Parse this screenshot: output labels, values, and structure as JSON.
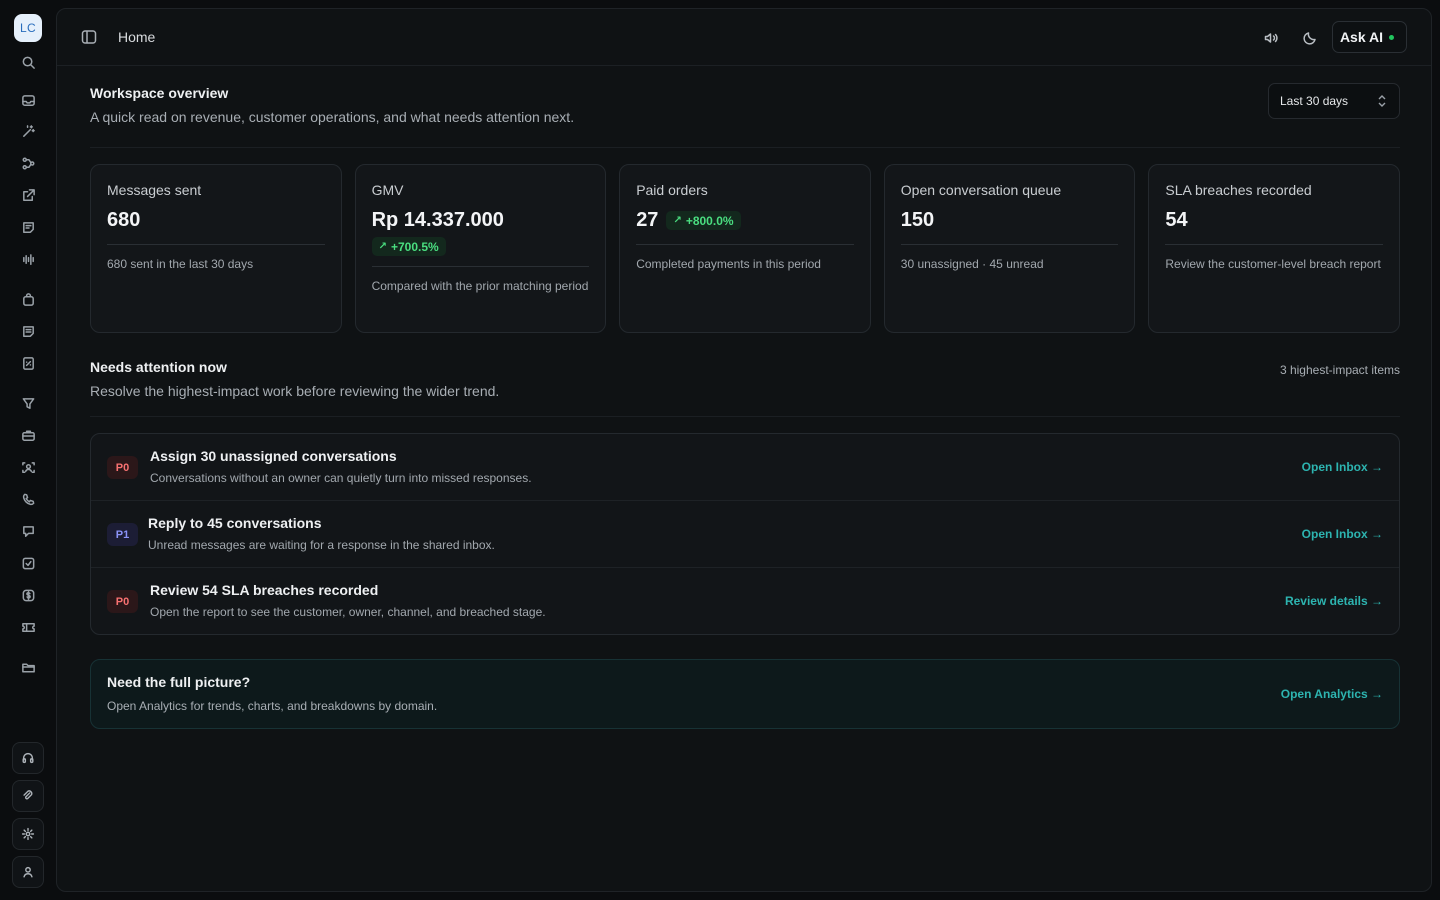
{
  "sidebar": {
    "avatar_initials": "LC",
    "icons": [
      "search-icon",
      "inbox-icon",
      "magic-wand-icon",
      "workflow-icon",
      "external-link-icon",
      "notes-icon",
      "audio-wave-icon",
      "bag-icon",
      "document-icon",
      "report-icon",
      "funnel-icon",
      "briefcase-icon",
      "face-scan-icon",
      "phone-icon",
      "chat-icon",
      "checkbox-icon",
      "dollar-icon",
      "ticket-icon",
      "folder-icon"
    ],
    "bottom_icons": [
      "headset-icon",
      "attachment-icon",
      "settings-icon",
      "user-icon"
    ]
  },
  "header": {
    "breadcrumb": "Home",
    "ask_ai_label": "Ask AI"
  },
  "overview": {
    "title": "Workspace overview",
    "subtitle": "A quick read on revenue, customer operations, and what needs attention next.",
    "range_value": "Last 30 days"
  },
  "cards": [
    {
      "title": "Messages sent",
      "value": "680",
      "badge": "",
      "note": "680 sent in the last 30 days"
    },
    {
      "title": "GMV",
      "value": "Rp 14.337.000",
      "badge": "+700.5%",
      "note": "Compared with the prior matching period"
    },
    {
      "title": "Paid orders",
      "value": "27",
      "badge": "+800.0%",
      "note": "Completed payments in this period"
    },
    {
      "title": "Open conversation queue",
      "value": "150",
      "badge": "",
      "note": "30 unassigned · 45 unread"
    },
    {
      "title": "SLA breaches recorded",
      "value": "54",
      "badge": "",
      "note": "Review the customer-level breach report"
    }
  ],
  "attention": {
    "title": "Needs attention now",
    "subtitle": "Resolve the highest-impact work before reviewing the wider trend.",
    "count_label": "3 highest-impact items",
    "items": [
      {
        "priority": "P0",
        "title": "Assign 30 unassigned conversations",
        "desc": "Conversations without an owner can quietly turn into missed responses.",
        "link": "Open Inbox →"
      },
      {
        "priority": "P1",
        "title": "Reply to 45 conversations",
        "desc": "Unread messages are waiting for a response in the shared inbox.",
        "link": "Open Inbox →"
      },
      {
        "priority": "P0",
        "title": "Review 54 SLA breaches recorded",
        "desc": "Open the report to see the customer, owner, channel, and breached stage.",
        "link": "Review details →"
      }
    ]
  },
  "cta": {
    "title": "Need the full picture?",
    "desc": "Open Analytics for trends, charts, and breakdowns by domain.",
    "link": "Open Analytics →"
  },
  "colors": {
    "accent_teal": "#2db4b0",
    "success_green": "#4ade80",
    "p0_red": "#f87171",
    "p1_indigo": "#8b93f8",
    "status_dot": "#22c55e"
  }
}
